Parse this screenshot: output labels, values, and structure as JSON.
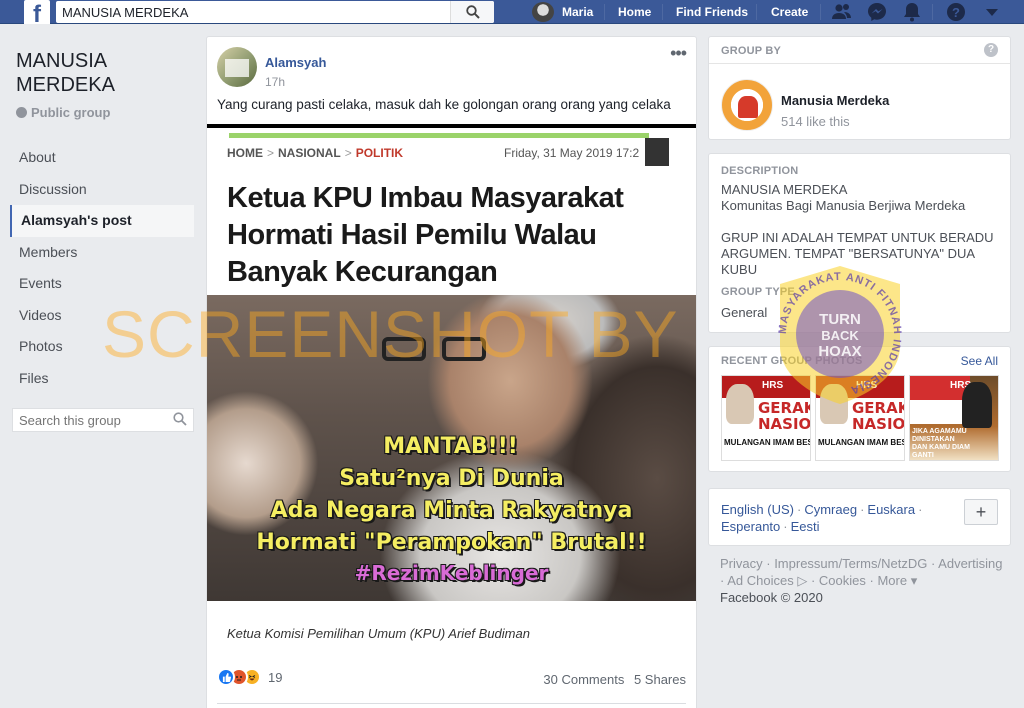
{
  "topbar": {
    "logo": "f",
    "search_value": "MANUSIA MERDEKA",
    "user_name": "Maria",
    "links": [
      "Home",
      "Find Friends",
      "Create"
    ]
  },
  "group": {
    "title": "MANUSIA MERDEKA",
    "privacy": "Public group",
    "nav": [
      "About",
      "Discussion",
      "Alamsyah's post",
      "Members",
      "Events",
      "Videos",
      "Photos",
      "Files"
    ],
    "search_placeholder": "Search this group"
  },
  "post": {
    "author": "Alamsyah",
    "time": "17h",
    "menu": "•••",
    "text": "Yang curang pasti celaka, masuk dah ke golongan orang orang yang celaka",
    "article": {
      "crumbs": [
        "HOME",
        "NASIONAL",
        "POLITIK"
      ],
      "date": "Friday, 31 May 2019 17:2",
      "headline": "Ketua KPU Imbau Masyarakat Hormati Hasil Pemilu Walau Banyak Kecurangan",
      "overlay": [
        "MANTAB!!!",
        "Satu²nya Di Dunia",
        "Ada Negara Minta Rakyatnya",
        "Hormati \"Perampokan\" Brutal!!",
        "#RezimKeblinger"
      ],
      "caption": "Ketua Komisi Pemilihan Umum (KPU) Arief Budiman"
    },
    "reaction_count": "19",
    "comments": "30 Comments",
    "shares": "5 Shares"
  },
  "sidebar": {
    "group_by_header": "GROUP BY",
    "page_name": "Manusia Merdeka",
    "page_likes": "514 like this",
    "description_header": "DESCRIPTION",
    "description_lines": [
      "MANUSIA MERDEKA",
      "Komunitas Bagi Manusia Berjiwa Merdeka"
    ],
    "description_para": "GRUP INI ADALAH TEMPAT UNTUK BERADU ARGUMEN. TEMPAT \"BERSATUNYA\" DUA KUBU",
    "group_type_header": "GROUP TYPE",
    "group_type": "General",
    "photos_header": "RECENT GROUP PHOTOS",
    "see_all": "See All",
    "photo_tiles": [
      {
        "tag": "HRS",
        "big": "GERAKA NASIONA",
        "sub": "MULANGAN IMAM BES G MULIA HABIB RIZIEQ SY"
      },
      {
        "tag": "HRS",
        "big": "GERAKA NASIONA",
        "sub": "MULANGAN IMAM BES G MULIA HABIB RIZIEQ SY"
      },
      {
        "tag": "HRS",
        "big": "",
        "sub": "JIKA AGAMAMU DINISTAKAN DAN KAMU DIAM GANTI PAKAIANMU DENGAN KAIN KAFAN"
      }
    ],
    "languages": [
      "English (US)",
      "Cymraeg",
      "Euskara",
      "Esperanto",
      "Eesti"
    ],
    "plus": "+",
    "footer_links": [
      "Privacy",
      "Impressum/Terms/NetzDG",
      "Advertising",
      "Ad Choices",
      "Cookies",
      "More"
    ],
    "copyright": "Facebook © 2020"
  },
  "watermark": {
    "text": "SCREENSHOT BY",
    "seal_ring": "MASYARAKAT ANTI FITNAH INDONESIA",
    "seal_center": [
      "TURN",
      "BACK",
      "HOAX"
    ]
  },
  "colors": {
    "brand": "#3b5998",
    "link": "#365899",
    "watermark": "#ffaa1e"
  }
}
